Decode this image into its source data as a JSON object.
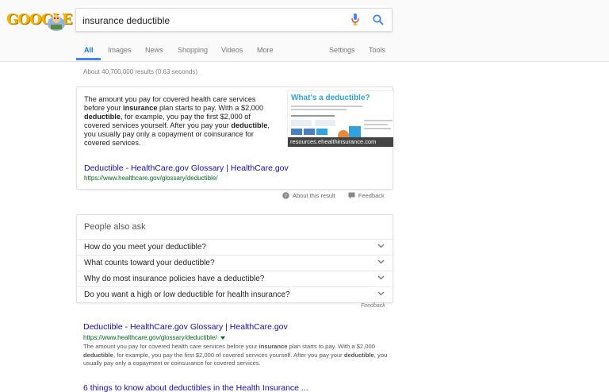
{
  "logo": {
    "text": "GOOGLE",
    "icon": "doodle-figure"
  },
  "search": {
    "value": "insurance deductible",
    "placeholder": ""
  },
  "tabs": [
    "All",
    "Images",
    "News",
    "Shopping",
    "Videos",
    "More"
  ],
  "tools": {
    "settings": "Settings",
    "tools": "Tools"
  },
  "result_stats": "About 40,700,000 results (0.63 seconds)",
  "snippet": {
    "text_parts": [
      "The amount you pay for covered health care services before your ",
      "insurance",
      " plan starts to pay. With a $2,000 ",
      "deductible",
      ", for example, you pay the first $2,000 of covered services yourself. After you pay your ",
      "deductible",
      ", you usually pay only a copayment or coinsurance for covered services."
    ],
    "image_title": "What's a deductible?",
    "image_caption": "resources.ehealthinsurance.com",
    "link": "Deductible - HealthCare.gov Glossary | HealthCare.gov",
    "url": "https://www.healthcare.gov/glossary/deductible/"
  },
  "about": {
    "about_label": "About this result",
    "feedback_label": "Feedback"
  },
  "people_also_ask": {
    "title": "People also ask",
    "questions": [
      "How do you meet your deductible?",
      "What counts toward your deductible?",
      "Why do most insurance policies have a deductible?",
      "Do you want a high or low deductible for health insurance?"
    ],
    "feedback": "Feedback"
  },
  "results": [
    {
      "title": "Deductible - HealthCare.gov Glossary | HealthCare.gov",
      "url": "https://www.healthcare.gov/glossary/deductible/",
      "snippet_parts": [
        "The amount you pay for covered health care services before your ",
        "insurance",
        " plan starts to pay. With a $2,000 ",
        "deductible",
        ", for example, you pay the first $2,000 of covered services yourself. After you pay your ",
        "deductible",
        ", you usually pay only a copayment or coinsurance for covered services."
      ]
    },
    {
      "title": "6 things to know about deductibles in the Health Insurance ..."
    }
  ],
  "colors": {
    "link": "#1a0dab",
    "url": "#006621",
    "accent": "#4285f4"
  }
}
